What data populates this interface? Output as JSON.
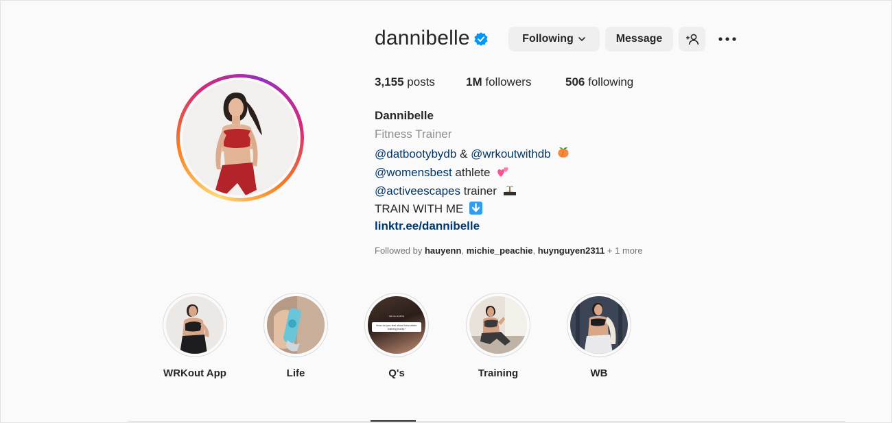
{
  "profile": {
    "username": "dannibelle",
    "verified": true,
    "buttons": {
      "following": "Following",
      "message": "Message"
    },
    "stats": {
      "posts_count": "3,155",
      "posts_label": "posts",
      "followers_count": "1M",
      "followers_label": "followers",
      "following_count": "506",
      "following_label": "following"
    },
    "name": "Dannibelle",
    "category": "Fitness Trainer",
    "bio": {
      "line1_mention1": "@datbootybydb",
      "line1_amp": " & ",
      "line1_mention2": "@wrkoutwithdb",
      "line2_mention": "@womensbest",
      "line2_text": " athlete",
      "line3_mention": "@activeescapes",
      "line3_text": " trainer",
      "line4_text": "TRAIN WITH ME"
    },
    "link": "linktr.ee/dannibelle",
    "followed_by": {
      "prefix": "Followed by ",
      "user1": "hauyenn",
      "sep1": ", ",
      "user2": "michie_peachie",
      "sep2": ", ",
      "user3": "huynguyen2311",
      "more": " + 1 more"
    }
  },
  "highlights": [
    {
      "label": "WRKout App"
    },
    {
      "label": "Life"
    },
    {
      "label": "Q's"
    },
    {
      "label": "Training"
    },
    {
      "label": "WB"
    }
  ],
  "story_text": {
    "small": "Ask me anything",
    "question": "How do you feel about keto when training booty?"
  },
  "colors": {
    "link": "#00376b",
    "verified": "#0095f6",
    "button_bg": "#efefef",
    "muted": "#8e8e8e"
  }
}
